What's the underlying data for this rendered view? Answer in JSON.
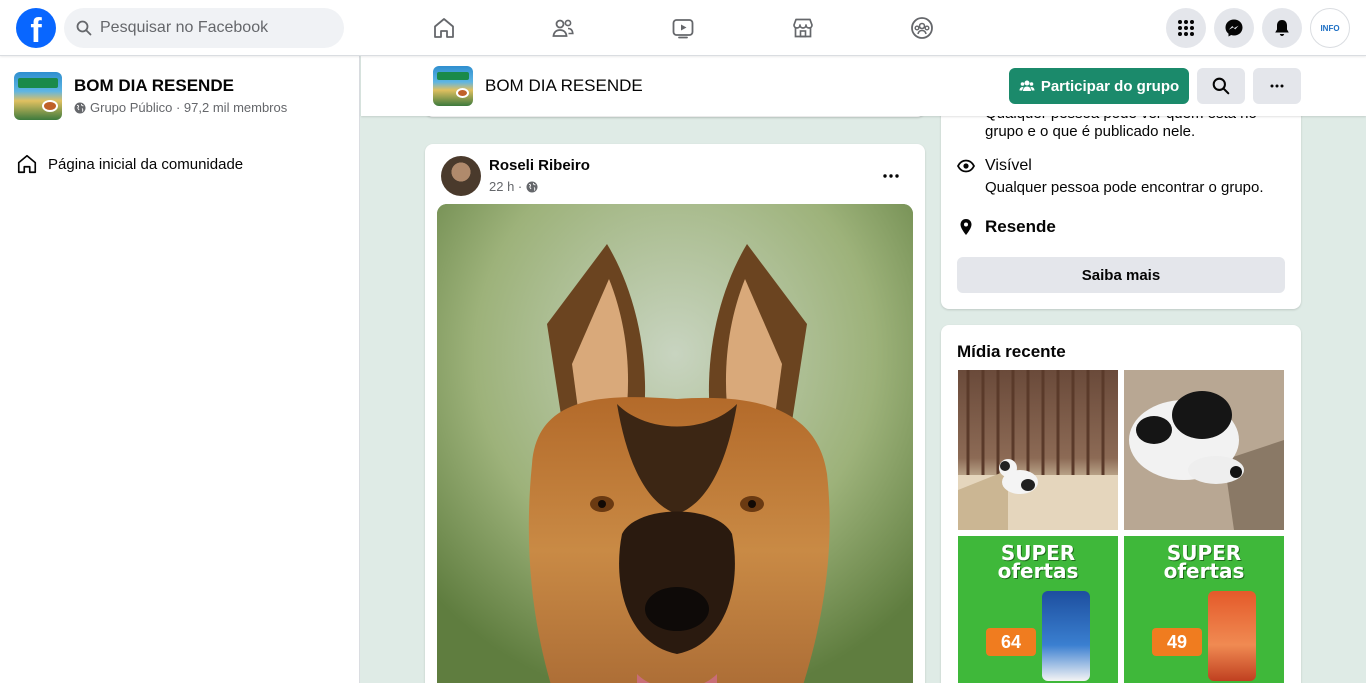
{
  "topbar": {
    "logo_letter": "f",
    "search_placeholder": "Pesquisar no Facebook",
    "nav_icons": [
      "home-icon",
      "friends-icon",
      "watch-icon",
      "marketplace-icon",
      "groups-icon"
    ],
    "right_icons": [
      "menu-grid-icon",
      "messenger-icon",
      "notifications-icon"
    ],
    "profile_text": "INFO"
  },
  "sidebar": {
    "group_name": "BOM DIA RESENDE",
    "group_meta": "Grupo Público · 97,2 mil membros",
    "nav_items": [
      {
        "label": "Página inicial da comunidade",
        "icon": "home-icon"
      }
    ]
  },
  "group_header": {
    "title": "BOM DIA RESENDE",
    "join_label": "Participar do grupo",
    "accent_color": "#1b8a6b"
  },
  "post": {
    "author": "Roseli Ribeiro",
    "time": "22 h ·",
    "privacy_icon": "globe-icon"
  },
  "about": {
    "partial_text_1": "Qualquer pessoa pode ver quem está no",
    "partial_text_2": "grupo e o que é publicado nele.",
    "visible_title": "Visível",
    "visible_desc": "Qualquer pessoa pode encontrar o grupo.",
    "location": "Resende",
    "learn_more": "Saiba mais"
  },
  "media": {
    "title": "Mídia recente",
    "promo_line1": "SUPER",
    "promo_line2": "ofertas",
    "prices": [
      "64",
      "49"
    ]
  }
}
